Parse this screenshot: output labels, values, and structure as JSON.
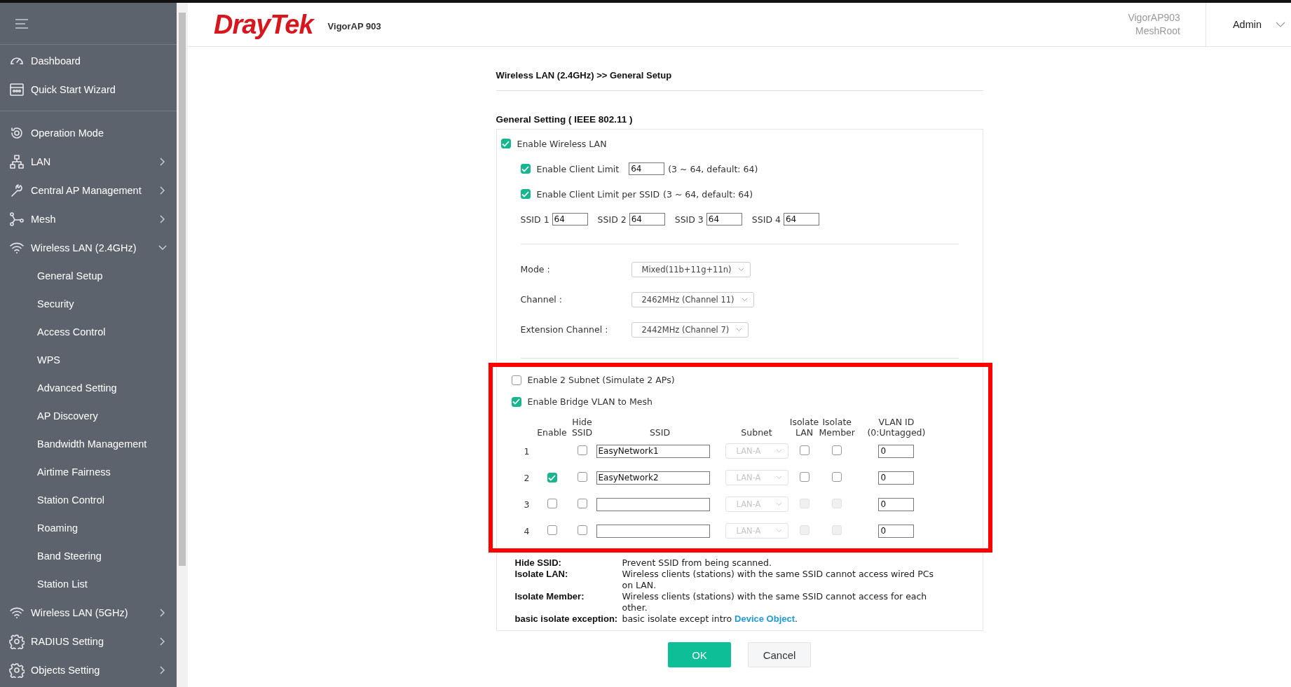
{
  "header": {
    "logo": "DrayTek",
    "model": "VigorAP 903",
    "device_name": "VigorAP903",
    "device_role": "MeshRoot",
    "user": "Admin"
  },
  "sidebar": {
    "groups": [
      [
        {
          "label": "Dashboard"
        },
        {
          "label": "Quick Start Wizard"
        }
      ],
      [
        {
          "label": "Operation Mode"
        },
        {
          "label": "LAN",
          "expandable": true,
          "expanded": false
        },
        {
          "label": "Central AP Management",
          "expandable": true,
          "expanded": false
        },
        {
          "label": "Mesh",
          "expandable": true,
          "expanded": false
        },
        {
          "label": "Wireless LAN (2.4GHz)",
          "expandable": true,
          "expanded": true,
          "children": [
            {
              "label": "General Setup"
            },
            {
              "label": "Security"
            },
            {
              "label": "Access Control"
            },
            {
              "label": "WPS"
            },
            {
              "label": "Advanced Setting"
            },
            {
              "label": "AP Discovery"
            },
            {
              "label": "Bandwidth Management"
            },
            {
              "label": "Airtime Fairness"
            },
            {
              "label": "Station Control"
            },
            {
              "label": "Roaming"
            },
            {
              "label": "Band Steering"
            },
            {
              "label": "Station List"
            }
          ]
        },
        {
          "label": "Wireless LAN (5GHz)",
          "expandable": true,
          "expanded": false
        },
        {
          "label": "RADIUS Setting",
          "expandable": true,
          "expanded": false
        },
        {
          "label": "Objects Setting",
          "expandable": true,
          "expanded": false
        }
      ]
    ]
  },
  "page": {
    "breadcrumb": "Wireless LAN (2.4GHz) >> General Setup",
    "section_title": "General Setting ( IEEE 802.11 )",
    "enable_wlan": {
      "label": "Enable Wireless LAN",
      "checked": true
    },
    "client_limit": {
      "label": "Enable Client Limit",
      "checked": true,
      "value": "64",
      "hint": "(3 ~ 64, default: 64)"
    },
    "client_limit_per_ssid": {
      "label": "Enable Client Limit per SSID",
      "checked": true,
      "hint": "(3 ~ 64, default: 64)"
    },
    "ssid_limits": [
      {
        "label": "SSID 1",
        "value": "64"
      },
      {
        "label": "SSID 2",
        "value": "64"
      },
      {
        "label": "SSID 3",
        "value": "64"
      },
      {
        "label": "SSID 4",
        "value": "64"
      }
    ],
    "selects": [
      {
        "label": "Mode :",
        "value": "Mixed(11b+11g+11n)"
      },
      {
        "label": "Channel :",
        "value": "2462MHz (Channel 11)"
      },
      {
        "label": "Extension Channel :",
        "value": "2442MHz (Channel 7)"
      }
    ],
    "bridge_section": {
      "highlighted": true,
      "options": [
        {
          "label": "Enable 2 Subnet (Simulate 2 APs)",
          "checked": false
        },
        {
          "label": "Enable Bridge VLAN to Mesh",
          "checked": true
        }
      ],
      "columns": [
        "Enable",
        "Hide SSID",
        "SSID",
        "Subnet",
        "Isolate LAN",
        "Isolate Member",
        "VLAN ID (0:Untagged)"
      ],
      "rows": [
        {
          "index": "1",
          "hide_ssid": false,
          "ssid": "EasyNetwork1",
          "subnet": "LAN-A",
          "isolate_lan": false,
          "isolate_member": false,
          "isolate_disabled": false,
          "vlan_id": "0"
        },
        {
          "index": "2",
          "enabled": true,
          "hide_ssid": false,
          "ssid": "EasyNetwork2",
          "subnet": "LAN-A",
          "isolate_lan": false,
          "isolate_member": false,
          "isolate_disabled": false,
          "vlan_id": "0"
        },
        {
          "index": "3",
          "enabled": false,
          "hide_ssid": false,
          "subnet": "LAN-A",
          "isolate_lan": false,
          "isolate_member": false,
          "isolate_disabled": true,
          "vlan_id": "0"
        },
        {
          "index": "4",
          "enabled": false,
          "hide_ssid": false,
          "subnet": "LAN-A",
          "isolate_lan": false,
          "isolate_member": false,
          "isolate_disabled": true,
          "vlan_id": "0"
        }
      ]
    },
    "notes": [
      {
        "term": "Hide SSID:",
        "text": "Prevent SSID from being scanned."
      },
      {
        "term": "Isolate LAN:",
        "text": "Wireless clients (stations) with the same SSID cannot access wired PCs on LAN."
      },
      {
        "term": "Isolate Member:",
        "text": "Wireless clients (stations) with the same SSID cannot access for each other."
      },
      {
        "term": "basic isolate exception:",
        "text": "basic isolate except intro",
        "link": "Device Object",
        "text_after": "."
      }
    ],
    "buttons": [
      {
        "label": "OK",
        "kind": "primary"
      },
      {
        "label": "Cancel",
        "kind": "secondary"
      }
    ]
  }
}
